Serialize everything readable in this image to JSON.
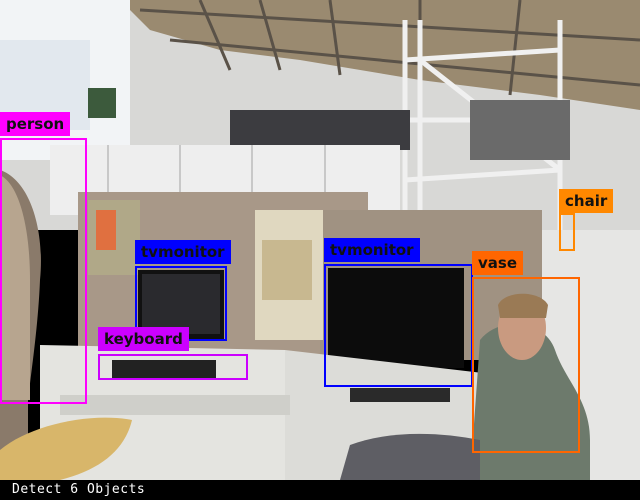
{
  "status_text": "Detect 6 Objects",
  "colors": {
    "person": "#ff00ff",
    "tvmonitor": "#0000ff",
    "keyboard": "#cc00ff",
    "chair": "#ff8800",
    "vase": "#ff6600"
  },
  "detections": [
    {
      "label": "person",
      "color": "#ff00ff"
    },
    {
      "label": "tvmonitor",
      "color": "#0000ff"
    },
    {
      "label": "tvmonitor",
      "color": "#0000ff"
    },
    {
      "label": "keyboard",
      "color": "#cc00ff"
    },
    {
      "label": "chair",
      "color": "#ff8800"
    },
    {
      "label": "vase",
      "color": "#ff6600"
    }
  ]
}
